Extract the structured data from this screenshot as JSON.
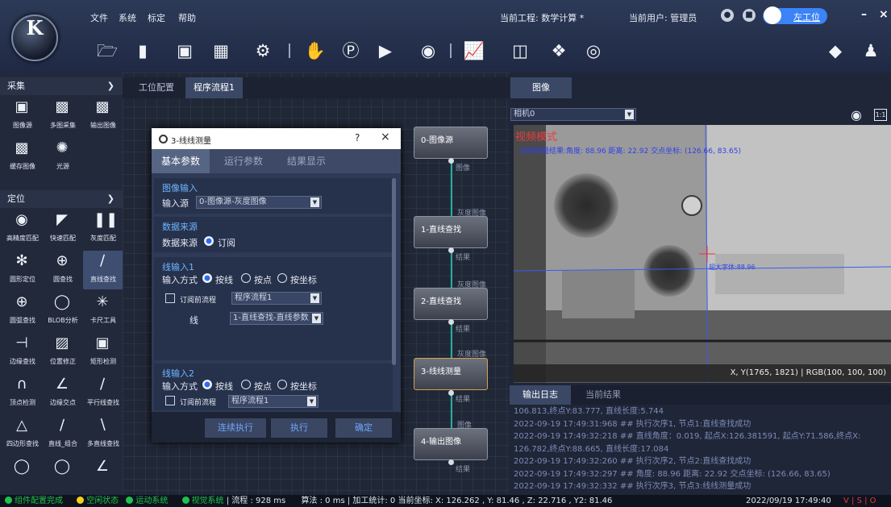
{
  "menu": {
    "file": "文件",
    "system": "系统",
    "calibrate": "标定",
    "help": "帮助"
  },
  "logo_letter": "K",
  "header": {
    "project": "当前工程: 数学计算 *",
    "user": "当前用户: 管理员",
    "toggle_label": "左工位",
    "minimize": "–",
    "close": "×"
  },
  "toolbar_icons": [
    "folder-open-icon",
    "new-file-icon",
    "save-icon",
    "save-as-icon",
    "settings-gear-icon",
    "hand-tool-icon",
    "p-circle-icon",
    "play-icon",
    "stop-icon",
    "chart-icon",
    "scale-icon",
    "3d-cube-icon",
    "camera-icon",
    "diamond-warning-icon",
    "user-admin-icon"
  ],
  "left_panel": {
    "group1": {
      "title": "采集",
      "tools": [
        "图像源",
        "多图采集",
        "输出图像",
        "缓存图像",
        "光源"
      ]
    },
    "group2": {
      "title": "定位",
      "tools": [
        "高精度匹配",
        "快速匹配",
        "灰度匹配",
        "圆形定位",
        "圆查找",
        "直线查找",
        "圆弧查找",
        "BLOB分析",
        "卡尺工具",
        "边缘查找",
        "位置修正",
        "矩形检测",
        "顶点检测",
        "边缘交点",
        "平行线查找",
        "四边形查找",
        "直线_组合",
        "多直线查找",
        "",
        "",
        ""
      ]
    }
  },
  "center": {
    "tabs": [
      "工位配置",
      "程序流程1"
    ],
    "dialog": {
      "title": "3-线线测量",
      "help": "?",
      "close": "×",
      "tabs": [
        "基本参数",
        "运行参数",
        "结果显示"
      ],
      "image_input": {
        "section": "图像输入",
        "source_label": "输入源",
        "source_value": "0-图像源-灰度图像"
      },
      "data_source": {
        "section": "数据来源",
        "label": "数据来源",
        "option": "订阅"
      },
      "line1": {
        "section": "线输入1",
        "mode_label": "输入方式",
        "opt1": "按线",
        "opt2": "按点",
        "opt3": "按坐标",
        "subscribe_label": "订阅前流程",
        "subscribe_value": "程序流程1",
        "line_label": "线",
        "line_value": "1-直线查找-直线参数"
      },
      "line2": {
        "section": "线输入2",
        "mode_label": "输入方式",
        "opt1": "按线",
        "opt2": "按点",
        "opt3": "按坐标",
        "subscribe_label": "订阅前流程",
        "subscribe_value": "程序流程1"
      },
      "buttons": {
        "continuous": "连续执行",
        "execute": "执行",
        "confirm": "确定"
      }
    },
    "flow": {
      "nodes": [
        {
          "title": "0-图像源"
        },
        {
          "title": "1-直线查找"
        },
        {
          "title": "2-直线查找"
        },
        {
          "title": "3-线线测量"
        },
        {
          "title": "4-输出图像"
        }
      ],
      "ports": {
        "image": "图像",
        "gray": "灰度图像",
        "result": "结果"
      }
    }
  },
  "right": {
    "tab": "图像",
    "camera": "相机0",
    "overlay": {
      "mode": "视频模式",
      "result": "线线测量结果:角度: 88.96 距离: 22.92 交点坐标: (126.66, 83.65)",
      "crosslabel": "超大字体:88.96"
    },
    "pixel_info": "X, Y(1765, 1821) | RGB(100, 100, 100)",
    "log_tabs": [
      "输出日志",
      "当前结果"
    ],
    "log": [
      "106.813,终点Y:83.777, 直线长度:5.744",
      "2022-09-19 17:49:31:968 ## 执行次序1, 节点1:直线查找成功",
      "2022-09-19 17:49:32:218 ## 直线角度：0.019, 起点X:126.381591, 起点Y:71.586,终点X:",
      "126.782,终点Y:88.665, 直线长度:17.084",
      "2022-09-19 17:49:32:260 ## 执行次序2, 节点2:直线查找成功",
      "2022-09-19 17:49:32:297 ## 角度: 88.96 距离: 22.92 交点坐标: (126.66, 83.65)",
      "2022-09-19 17:49:32:332 ## 执行次序3, 节点3:线线测量成功"
    ]
  },
  "status": {
    "s1": "组件配置完成",
    "s2": "空闲状态",
    "s3": "运动系统",
    "s4": "视觉系统",
    "flow_time": "| 流程 : 928 ms",
    "algo": "算法 : 0 ms | 加工统计: 0  当前坐标: X: 126.262 , Y: 81.46 , Z: 22.716 , Y2: 81.46",
    "datetime": "2022/09/19 17:49:40",
    "flags": "V | S | O"
  },
  "colors": {
    "accent": "#3b83f6",
    "green": "#1fc24a",
    "yellow": "#f3d11b",
    "red": "#e03c3c",
    "teal": "#1fb0a0"
  }
}
